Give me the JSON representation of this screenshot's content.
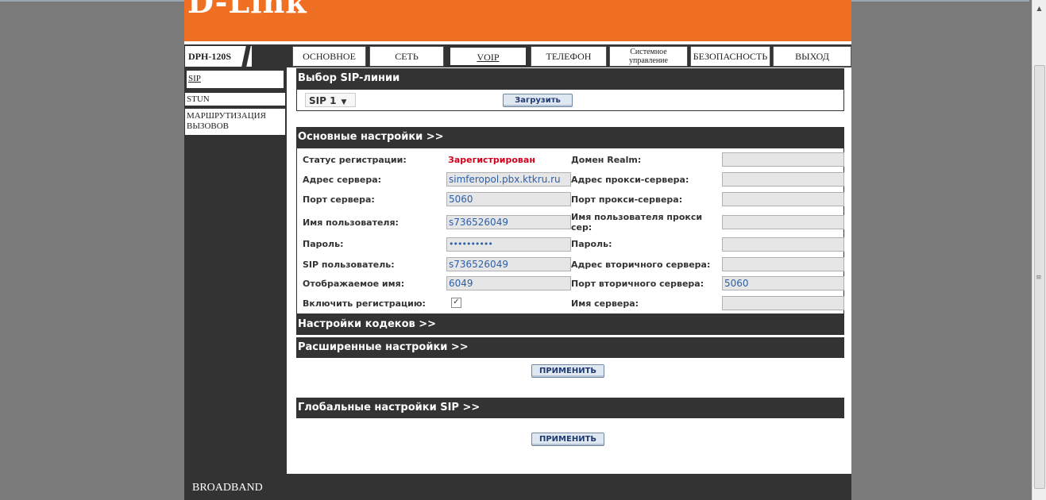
{
  "brand": {
    "logo_text": "D-Link",
    "model": "DPH-120S",
    "footer": "BROADBAND"
  },
  "tabs": [
    {
      "label": "ОСНОВНОЕ"
    },
    {
      "label": "СЕТЬ"
    },
    {
      "label": "VOIP"
    },
    {
      "label": "ТЕЛЕФОН"
    },
    {
      "label": "Системное управление"
    },
    {
      "label": "БЕЗОПАСНОСТЬ"
    },
    {
      "label": "ВЫХОД"
    }
  ],
  "sidebar": {
    "items": [
      {
        "label": "SIP"
      },
      {
        "label": "STUN"
      },
      {
        "label": "МАРШРУТИЗАЦИЯ ВЫЗОВОВ"
      }
    ]
  },
  "line_select": {
    "title": "Выбор SIP-линии",
    "selected": "SIP 1",
    "load_button": "Загрузить"
  },
  "basic": {
    "title": "Основные настройки >>",
    "reg_status_label": "Статус регистрации:",
    "reg_status_value": "Зарегистрирован",
    "server_addr_label": "Адрес сервера:",
    "server_addr_value": "simferopol.pbx.ktkru.ru",
    "server_port_label": "Порт сервера:",
    "server_port_value": "5060",
    "username_label": "Имя пользователя:",
    "username_value": "s736526049",
    "password_label": "Пароль:",
    "password_value": "••••••••••",
    "sip_user_label": "SIP пользователь:",
    "sip_user_value": "s736526049",
    "display_name_label": "Отображаемое имя:",
    "display_name_value": "6049",
    "enable_reg_label": "Включить регистрацию:",
    "enable_reg_checked": true,
    "realm_label": "Домен Realm:",
    "realm_value": "",
    "proxy_addr_label": "Адрес прокси-сервера:",
    "proxy_addr_value": "",
    "proxy_port_label": "Порт прокси-сервера:",
    "proxy_port_value": "",
    "proxy_user_label": "Имя пользователя прокси сер:",
    "proxy_user_value": "",
    "proxy_pass_label": "Пароль:",
    "proxy_pass_value": "",
    "secondary_addr_label": "Адрес вторичного сервера:",
    "secondary_addr_value": "",
    "secondary_port_label": "Порт вторичного сервера:",
    "secondary_port_value": "5060",
    "server_name_label": "Имя сервера:",
    "server_name_value": ""
  },
  "codec": {
    "title": "Настройки кодеков >>"
  },
  "advanced": {
    "title": "Расширенные настройки >>"
  },
  "apply_button": "ПРИМЕНИТЬ",
  "global": {
    "title": "Глобальные настройки SIP >>"
  },
  "apply_button_2": "ПРИМЕНИТЬ"
}
